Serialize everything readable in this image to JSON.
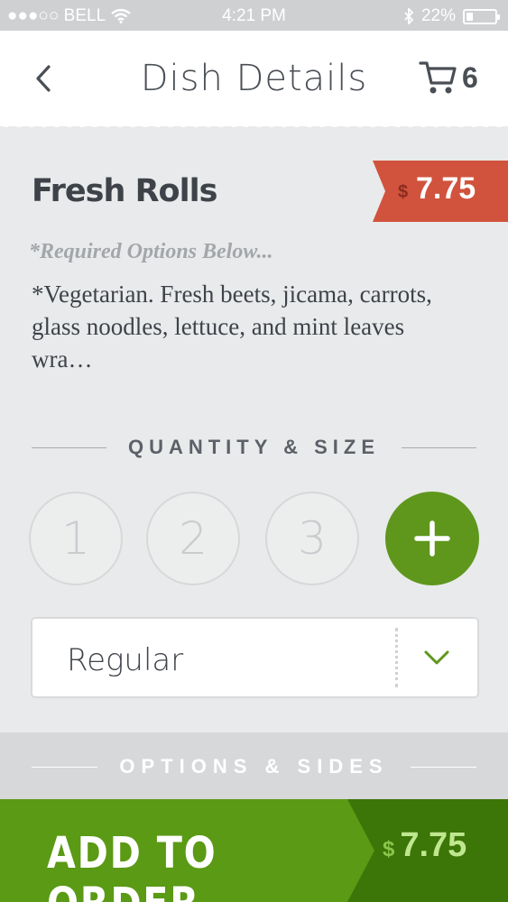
{
  "status_bar": {
    "carrier": "●●●○○ BELL",
    "time": "4:21 PM",
    "battery": "22%"
  },
  "nav": {
    "title": "Dish Details",
    "cart_count": "6"
  },
  "dish": {
    "name": "Fresh Rolls",
    "price_currency": "$",
    "price": "7.75",
    "required_note": "*Required Options Below...",
    "description": "*Vegetarian. Fresh beets, jicama, carrots, glass noodles, lettuce, and mint leaves wra…"
  },
  "quantity_size": {
    "label": "QUANTITY & SIZE",
    "quantities": [
      "1",
      "2",
      "3"
    ],
    "selected_size": "Regular"
  },
  "options_sides": {
    "label": "OPTIONS & SIDES"
  },
  "add_to_order": {
    "label": "ADD TO ORDER",
    "currency": "$",
    "price": "7.75"
  },
  "colors": {
    "price_tag": "#d1533d",
    "accent_green": "#5e971c",
    "dark_green": "#3c7508"
  }
}
